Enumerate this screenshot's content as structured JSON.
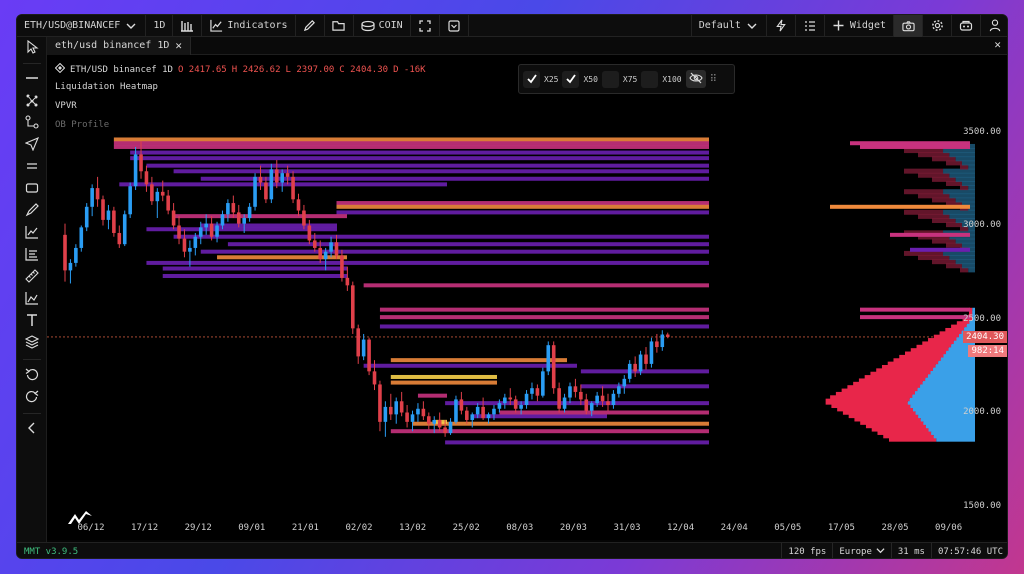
{
  "toolbar": {
    "symbol": "ETH/USD@BINANCEF",
    "interval": "1D",
    "indicators": "Indicators",
    "coin": "COIN",
    "layout": "Default",
    "widget": "Widget"
  },
  "tab": {
    "label": "eth/usd binancef 1D"
  },
  "legend": {
    "name": "ETH/USD binancef 1D",
    "open": "O 2417.65",
    "high": "H 2426.62",
    "low": "L 2397.00",
    "close": "C 2404.30",
    "delta": "D -16K",
    "indicators": [
      "Liquidation Heatmap",
      "VPVR",
      "OB Profile"
    ]
  },
  "leverage": {
    "x25": "X25",
    "x50": "X50",
    "x75": "X75",
    "x100": "X100",
    "checked": {
      "x25": true,
      "x50": true,
      "x75": false,
      "x100": false
    }
  },
  "price_axis": {
    "ticks": [
      "3500.00",
      "3000.00",
      "2500.00",
      "2000.00",
      "1500.00"
    ],
    "last_price": "2404.30",
    "countdown": "982:14"
  },
  "time_axis": [
    "06/12",
    "17/12",
    "29/12",
    "09/01",
    "21/01",
    "02/02",
    "13/02",
    "25/02",
    "08/03",
    "20/03",
    "31/03",
    "12/04",
    "24/04",
    "05/05",
    "17/05",
    "28/05",
    "09/06"
  ],
  "status": {
    "version": "MMT v3.9.5",
    "fps": "120 fps",
    "region": "Europe",
    "latency": "31 ms",
    "clock": "07:57:46 UTC"
  },
  "colors": {
    "up": "#2a9df4",
    "down": "#e0404a",
    "heat_low": "#6a1fb0",
    "heat_mid": "#c8327e",
    "heat_high": "#f08a3c",
    "heat_max": "#f7d14a",
    "vol_sell": "#e8264a",
    "vol_buy": "#3aa0e8"
  },
  "chart_data": {
    "type": "candlestick",
    "ylim": [
      1500,
      3600
    ],
    "candles": [
      [
        2950,
        3010,
        2700,
        2760
      ],
      [
        2760,
        2820,
        2690,
        2800
      ],
      [
        2800,
        2900,
        2780,
        2880
      ],
      [
        2880,
        3000,
        2860,
        2990
      ],
      [
        2990,
        3120,
        2970,
        3100
      ],
      [
        3100,
        3220,
        3050,
        3200
      ],
      [
        3200,
        3260,
        3100,
        3140
      ],
      [
        3140,
        3160,
        3000,
        3030
      ],
      [
        3030,
        3110,
        2980,
        3080
      ],
      [
        3080,
        3100,
        2940,
        2960
      ],
      [
        2960,
        3000,
        2880,
        2900
      ],
      [
        2900,
        3080,
        2890,
        3060
      ],
      [
        3060,
        3230,
        3040,
        3210
      ],
      [
        3210,
        3420,
        3190,
        3380
      ],
      [
        3380,
        3450,
        3250,
        3290
      ],
      [
        3290,
        3320,
        3180,
        3220
      ],
      [
        3220,
        3260,
        3110,
        3130
      ],
      [
        3130,
        3200,
        3040,
        3180
      ],
      [
        3180,
        3240,
        3130,
        3160
      ],
      [
        3160,
        3190,
        3060,
        3080
      ],
      [
        3080,
        3120,
        2980,
        3000
      ],
      [
        3000,
        3050,
        2900,
        2930
      ],
      [
        2930,
        2980,
        2830,
        2860
      ],
      [
        2860,
        2920,
        2780,
        2880
      ],
      [
        2880,
        2960,
        2840,
        2940
      ],
      [
        2940,
        3020,
        2900,
        2990
      ],
      [
        2990,
        3060,
        2950,
        3010
      ],
      [
        3010,
        3050,
        2920,
        2940
      ],
      [
        2940,
        3020,
        2910,
        3000
      ],
      [
        3000,
        3080,
        2980,
        3060
      ],
      [
        3060,
        3140,
        3020,
        3120
      ],
      [
        3120,
        3160,
        3040,
        3070
      ],
      [
        3070,
        3110,
        2990,
        3010
      ],
      [
        3010,
        3060,
        2960,
        3040
      ],
      [
        3040,
        3120,
        3020,
        3100
      ],
      [
        3100,
        3280,
        3080,
        3260
      ],
      [
        3260,
        3320,
        3190,
        3230
      ],
      [
        3230,
        3260,
        3120,
        3140
      ],
      [
        3140,
        3330,
        3120,
        3300
      ],
      [
        3300,
        3350,
        3200,
        3230
      ],
      [
        3230,
        3300,
        3180,
        3280
      ],
      [
        3280,
        3320,
        3220,
        3260
      ],
      [
        3260,
        3290,
        3120,
        3140
      ],
      [
        3140,
        3170,
        3050,
        3080
      ],
      [
        3080,
        3110,
        2980,
        3000
      ],
      [
        3000,
        3030,
        2900,
        2920
      ],
      [
        2920,
        2960,
        2860,
        2880
      ],
      [
        2880,
        2920,
        2800,
        2820
      ],
      [
        2820,
        2880,
        2760,
        2860
      ],
      [
        2860,
        2940,
        2830,
        2910
      ],
      [
        2910,
        2950,
        2820,
        2840
      ],
      [
        2840,
        2870,
        2700,
        2720
      ],
      [
        2720,
        2780,
        2650,
        2680
      ],
      [
        2680,
        2700,
        2420,
        2450
      ],
      [
        2450,
        2470,
        2260,
        2300
      ],
      [
        2300,
        2420,
        2280,
        2390
      ],
      [
        2390,
        2400,
        2200,
        2220
      ],
      [
        2220,
        2280,
        2120,
        2150
      ],
      [
        2150,
        2170,
        1900,
        1950
      ],
      [
        1950,
        2060,
        1870,
        2030
      ],
      [
        2030,
        2100,
        1960,
        1990
      ],
      [
        1990,
        2080,
        1940,
        2060
      ],
      [
        2060,
        2110,
        1980,
        2000
      ],
      [
        2000,
        2040,
        1920,
        1950
      ],
      [
        1950,
        2010,
        1900,
        1990
      ],
      [
        1990,
        2050,
        1950,
        2020
      ],
      [
        2020,
        2060,
        1960,
        1980
      ],
      [
        1980,
        2000,
        1910,
        1940
      ],
      [
        1940,
        1980,
        1890,
        1960
      ],
      [
        1960,
        2000,
        1900,
        1920
      ],
      [
        1920,
        1960,
        1870,
        1890
      ],
      [
        1890,
        1970,
        1880,
        1950
      ],
      [
        1950,
        2090,
        1940,
        2070
      ],
      [
        2070,
        2110,
        1990,
        2010
      ],
      [
        2010,
        2030,
        1940,
        1960
      ],
      [
        1960,
        2000,
        1920,
        1990
      ],
      [
        1990,
        2050,
        1970,
        2030
      ],
      [
        2030,
        2080,
        1960,
        1970
      ],
      [
        1970,
        2000,
        1940,
        1990
      ],
      [
        1990,
        2040,
        1960,
        2020
      ],
      [
        2020,
        2070,
        2000,
        2050
      ],
      [
        2050,
        2100,
        2020,
        2080
      ],
      [
        2080,
        2130,
        2040,
        2070
      ],
      [
        2070,
        2090,
        2000,
        2020
      ],
      [
        2020,
        2060,
        1990,
        2040
      ],
      [
        2040,
        2120,
        2020,
        2100
      ],
      [
        2100,
        2160,
        2070,
        2130
      ],
      [
        2130,
        2150,
        2060,
        2090
      ],
      [
        2090,
        2240,
        2080,
        2220
      ],
      [
        2220,
        2380,
        2200,
        2360
      ],
      [
        2360,
        2380,
        2100,
        2130
      ],
      [
        2130,
        2160,
        2000,
        2020
      ],
      [
        2020,
        2100,
        2000,
        2080
      ],
      [
        2080,
        2160,
        2050,
        2140
      ],
      [
        2140,
        2180,
        2080,
        2110
      ],
      [
        2110,
        2150,
        2040,
        2070
      ],
      [
        2070,
        2100,
        1990,
        2010
      ],
      [
        2010,
        2060,
        1980,
        2050
      ],
      [
        2050,
        2110,
        2030,
        2090
      ],
      [
        2090,
        2140,
        2030,
        2060
      ],
      [
        2060,
        2100,
        2010,
        2040
      ],
      [
        2040,
        2120,
        2020,
        2100
      ],
      [
        2100,
        2160,
        2080,
        2140
      ],
      [
        2140,
        2200,
        2100,
        2180
      ],
      [
        2180,
        2280,
        2160,
        2260
      ],
      [
        2260,
        2300,
        2190,
        2220
      ],
      [
        2220,
        2330,
        2200,
        2310
      ],
      [
        2310,
        2350,
        2230,
        2260
      ],
      [
        2260,
        2400,
        2240,
        2380
      ],
      [
        2380,
        2420,
        2320,
        2350
      ],
      [
        2350,
        2440,
        2330,
        2417
      ],
      [
        2417,
        2427,
        2397,
        2404
      ]
    ]
  }
}
